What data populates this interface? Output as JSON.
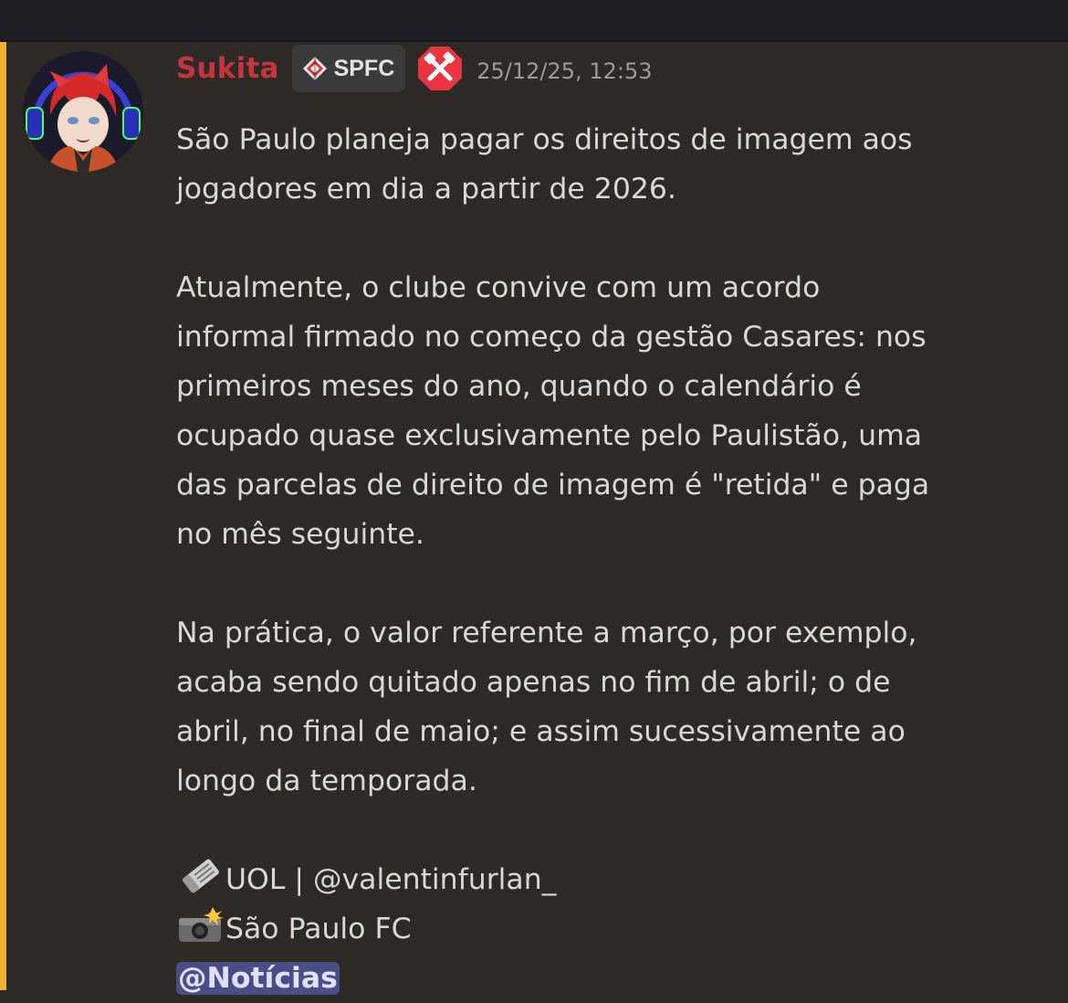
{
  "colors": {
    "mention_stripe": "#f0b132",
    "username": "#c5343f",
    "role_icon_bg": "#e8353f",
    "mention_bg": "#4a4e86"
  },
  "message": {
    "author": "Sukita",
    "tag": "SPFC",
    "timestamp": "25/12/25, 12:53",
    "avatar_icon": "avatar-icon",
    "role_icon": "tools-icon",
    "paragraph1": [
      "São Paulo planeja pagar os direitos de imagem aos",
      "jogadores em dia a partir de 2026."
    ],
    "paragraph2": [
      "Atualmente, o clube convive com um acordo",
      "informal firmado no começo da gestão Casares: nos",
      "primeiros meses do ano, quando o calendário é",
      "ocupado quase exclusivamente pelo Paulistão, uma",
      "das parcelas de direito de imagem é \"retida\" e paga",
      "no mês seguinte."
    ],
    "paragraph3": [
      "Na prática, o valor referente a março, por exemplo,",
      "acaba sendo quitado apenas no fim de abril; o de",
      "abril, no final de maio; e assim sucessivamente ao",
      "longo da temporada."
    ],
    "source": {
      "icon": "newspaper-icon",
      "text": "UOL | @valentinfurlan_"
    },
    "photo": {
      "icon": "camera-flash-icon",
      "text": "São Paulo FC"
    },
    "mention": "@Notícias"
  }
}
